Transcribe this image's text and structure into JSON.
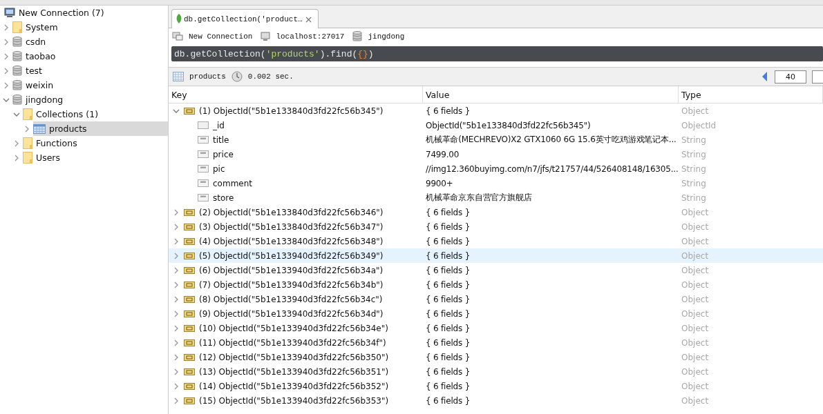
{
  "sidebar": {
    "items": [
      {
        "label": "New Connection (7)",
        "kind": "connection",
        "selected": false,
        "children": [
          {
            "label": "System",
            "kind": "folder",
            "expanded": false,
            "selected": false
          },
          {
            "label": "csdn",
            "kind": "database",
            "expanded": false,
            "selected": false
          },
          {
            "label": "taobao",
            "kind": "database",
            "expanded": false,
            "selected": false
          },
          {
            "label": "test",
            "kind": "database",
            "expanded": false,
            "selected": false
          },
          {
            "label": "weixin",
            "kind": "database",
            "expanded": false,
            "selected": false
          },
          {
            "label": "jingdong",
            "kind": "database",
            "expanded": true,
            "selected": false,
            "children": [
              {
                "label": "Collections (1)",
                "kind": "folder",
                "expanded": true,
                "selected": false,
                "children": [
                  {
                    "label": "products",
                    "kind": "collection",
                    "expanded": false,
                    "selected": true
                  }
                ]
              },
              {
                "label": "Functions",
                "kind": "folder",
                "expanded": false,
                "selected": false
              },
              {
                "label": "Users",
                "kind": "folder",
                "expanded": false,
                "selected": false
              }
            ]
          }
        ]
      }
    ]
  },
  "tabs": [
    {
      "label": "db.getCollection('product…",
      "selected": true,
      "close": "×"
    }
  ],
  "connection_bar": {
    "connection": "New Connection",
    "server": "localhost:27017",
    "database": "jingdong"
  },
  "query": {
    "prefix": "db.getCollection(",
    "string": "'products'",
    "suffix": ").find(",
    "braces": "{}",
    "close": ")"
  },
  "results_bar": {
    "collection": "products",
    "time": "0.002 sec.",
    "page_size": "40"
  },
  "table": {
    "columns": [
      "Key",
      "Value",
      "Type"
    ],
    "rows": [
      {
        "key": "(1) ObjectId(\"5b1e133840d3fd22fc56b345\")",
        "value": "{ 6 fields }",
        "type": "Object",
        "expanded": true,
        "selected": false,
        "children": [
          {
            "key": "_id",
            "value": "ObjectId(\"5b1e133840d3fd22fc56b345\")",
            "type": "ObjectId",
            "kind": "id"
          },
          {
            "key": "title",
            "value": "机械革命(MECHREVO)X2 GTX1060 6G 15.6英寸吃鸡游戏笔记本...",
            "type": "String",
            "kind": "string"
          },
          {
            "key": "price",
            "value": "7499.00",
            "type": "String",
            "kind": "string"
          },
          {
            "key": "pic",
            "value": "//img12.360buyimg.com/n7/jfs/t21757/44/526408148/16305...",
            "type": "String",
            "kind": "string"
          },
          {
            "key": "comment",
            "value": "9900+",
            "type": "String",
            "kind": "string"
          },
          {
            "key": "store",
            "value": "机械革命京东自营官方旗舰店",
            "type": "String",
            "kind": "string"
          }
        ]
      },
      {
        "key": "(2) ObjectId(\"5b1e133840d3fd22fc56b346\")",
        "value": "{ 6 fields }",
        "type": "Object",
        "expanded": false,
        "selected": false
      },
      {
        "key": "(3) ObjectId(\"5b1e133840d3fd22fc56b347\")",
        "value": "{ 6 fields }",
        "type": "Object",
        "expanded": false,
        "selected": false
      },
      {
        "key": "(4) ObjectId(\"5b1e133840d3fd22fc56b348\")",
        "value": "{ 6 fields }",
        "type": "Object",
        "expanded": false,
        "selected": false
      },
      {
        "key": "(5) ObjectId(\"5b1e133940d3fd22fc56b349\")",
        "value": "{ 6 fields }",
        "type": "Object",
        "expanded": false,
        "selected": true
      },
      {
        "key": "(6) ObjectId(\"5b1e133940d3fd22fc56b34a\")",
        "value": "{ 6 fields }",
        "type": "Object",
        "expanded": false,
        "selected": false
      },
      {
        "key": "(7) ObjectId(\"5b1e133940d3fd22fc56b34b\")",
        "value": "{ 6 fields }",
        "type": "Object",
        "expanded": false,
        "selected": false
      },
      {
        "key": "(8) ObjectId(\"5b1e133940d3fd22fc56b34c\")",
        "value": "{ 6 fields }",
        "type": "Object",
        "expanded": false,
        "selected": false
      },
      {
        "key": "(9) ObjectId(\"5b1e133940d3fd22fc56b34d\")",
        "value": "{ 6 fields }",
        "type": "Object",
        "expanded": false,
        "selected": false
      },
      {
        "key": "(10) ObjectId(\"5b1e133940d3fd22fc56b34e\")",
        "value": "{ 6 fields }",
        "type": "Object",
        "expanded": false,
        "selected": false
      },
      {
        "key": "(11) ObjectId(\"5b1e133940d3fd22fc56b34f\")",
        "value": "{ 6 fields }",
        "type": "Object",
        "expanded": false,
        "selected": false
      },
      {
        "key": "(12) ObjectId(\"5b1e133940d3fd22fc56b350\")",
        "value": "{ 6 fields }",
        "type": "Object",
        "expanded": false,
        "selected": false
      },
      {
        "key": "(13) ObjectId(\"5b1e133940d3fd22fc56b351\")",
        "value": "{ 6 fields }",
        "type": "Object",
        "expanded": false,
        "selected": false
      },
      {
        "key": "(14) ObjectId(\"5b1e133940d3fd22fc56b352\")",
        "value": "{ 6 fields }",
        "type": "Object",
        "expanded": false,
        "selected": false
      },
      {
        "key": "(15) ObjectId(\"5b1e133940d3fd22fc56b353\")",
        "value": "{ 6 fields }",
        "type": "Object",
        "expanded": false,
        "selected": false
      }
    ]
  }
}
